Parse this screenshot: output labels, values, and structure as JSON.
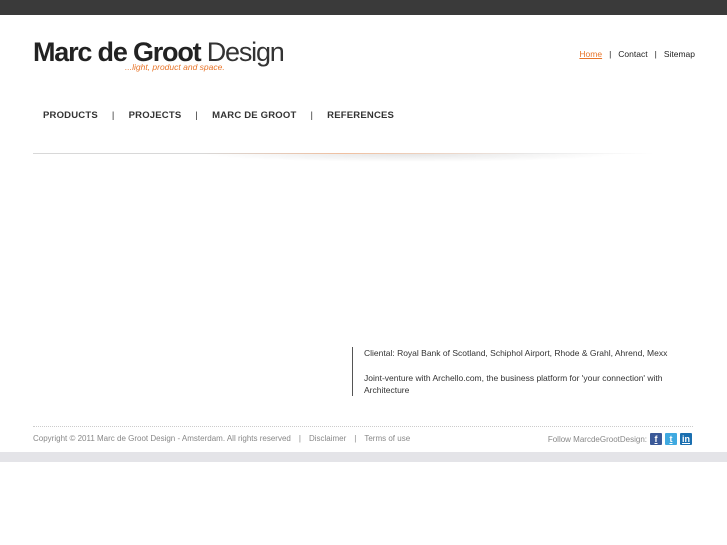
{
  "brand": {
    "name_bold": "Marc de Groot",
    "name_light": "Design",
    "tagline": "...light, product and space."
  },
  "top_links": [
    {
      "label": "Home",
      "active": true
    },
    {
      "label": "Contact",
      "active": false
    },
    {
      "label": "Sitemap",
      "active": false
    }
  ],
  "separator": "|",
  "main_nav": [
    {
      "label": "PRODUCTS"
    },
    {
      "label": "PROJECTS"
    },
    {
      "label": "MARC DE GROOT"
    },
    {
      "label": "REFERENCES"
    }
  ],
  "info": {
    "cliental": "Cliental: Royal Bank of Scotland, Schiphol Airport, Rhode & Grahl, Ahrend, Mexx",
    "jointventure": "Joint-venture with Archello.com, the business platform for 'your connection' with Architecture"
  },
  "footer": {
    "copyright": "Copyright © 2011 Marc de Groot Design - Amsterdam. All rights reserved",
    "disclaimer": "Disclaimer",
    "terms": "Terms of use",
    "follow": "Follow MarcdeGrootDesign:"
  },
  "social": [
    {
      "icon": "facebook-icon",
      "glyph": "f"
    },
    {
      "icon": "twitter-icon",
      "glyph": "t"
    },
    {
      "icon": "linkedin-icon",
      "glyph": "in"
    }
  ],
  "colors": {
    "accent": "#e8752a",
    "topbar": "#3a3a3a"
  }
}
